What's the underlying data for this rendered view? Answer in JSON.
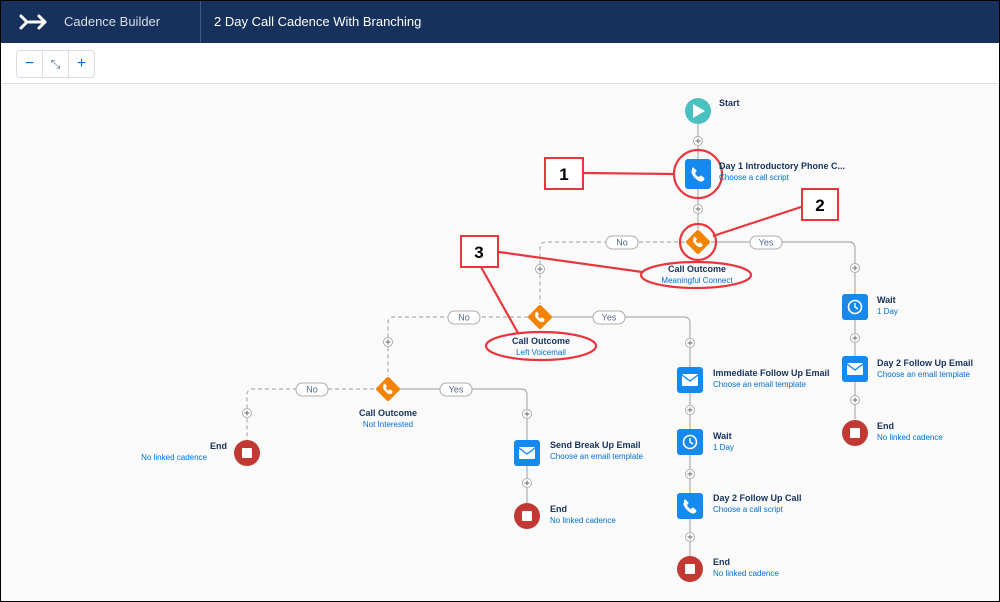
{
  "header": {
    "app_name": "Cadence Builder",
    "cadence_title": "2 Day Call Cadence With Branching"
  },
  "toolbar": {
    "zoom_out": "−",
    "fit": "⤡",
    "zoom_in": "+"
  },
  "branch": {
    "no": "No",
    "yes": "Yes"
  },
  "nodes": {
    "start": {
      "title": "Start"
    },
    "day1_call": {
      "title": "Day 1 Introductory Phone C...",
      "sub": "Choose a call script"
    },
    "outcome1": {
      "title": "Call Outcome",
      "sub": "Meaningful Connect"
    },
    "wait_right": {
      "title": "Wait",
      "sub": "1 Day"
    },
    "day2_email": {
      "title": "Day 2 Follow Up Email",
      "sub": "Choose an email template"
    },
    "end_right": {
      "title": "End",
      "sub": "No linked cadence"
    },
    "outcome2": {
      "title": "Call Outcome",
      "sub": "Left Voicemail"
    },
    "immediate_email": {
      "title": "Immediate Follow Up Email",
      "sub": "Choose an email template"
    },
    "wait_mid": {
      "title": "Wait",
      "sub": "1 Day"
    },
    "day2_call": {
      "title": "Day 2 Follow Up Call",
      "sub": "Choose a call script"
    },
    "end_mid": {
      "title": "End",
      "sub": "No linked cadence"
    },
    "outcome3": {
      "title": "Call Outcome",
      "sub": "Not Interested"
    },
    "breakup_email": {
      "title": "Send Break Up Email",
      "sub": "Choose an email template"
    },
    "end_breakup": {
      "title": "End",
      "sub": "No linked cadence"
    },
    "end_left": {
      "title": "End",
      "sub": "No linked cadence"
    }
  },
  "callouts": [
    "1",
    "2",
    "3"
  ],
  "colors": {
    "header": "#16325c",
    "step_blue": "#1589ee",
    "branch_orange": "#f38303",
    "start_teal": "#4bc0c0",
    "end_red": "#c23934",
    "callout_red": "#e8363c"
  }
}
